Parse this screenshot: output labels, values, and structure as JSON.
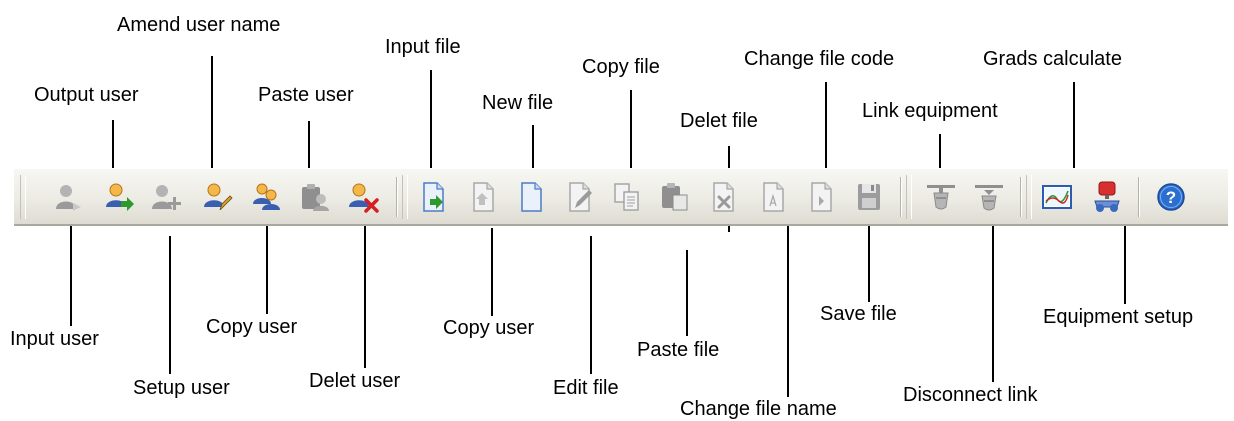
{
  "toolbar": {
    "buttons": [
      {
        "id": "input-user",
        "label": "Input user",
        "icon": "user-input-icon"
      },
      {
        "id": "output-user",
        "label": "Output user",
        "icon": "user-output-icon"
      },
      {
        "id": "setup-user",
        "label": "Setup user",
        "icon": "user-add-icon"
      },
      {
        "id": "amend-user-name",
        "label": "Amend user name",
        "icon": "user-edit-icon"
      },
      {
        "id": "copy-user",
        "label": "Copy user",
        "icon": "user-copy-icon"
      },
      {
        "id": "paste-user",
        "label": "Paste user",
        "icon": "user-paste-icon"
      },
      {
        "id": "delet-user",
        "label": "Delet user",
        "icon": "user-delete-icon"
      },
      {
        "id": "input-file",
        "label": "Input file",
        "icon": "file-import-icon"
      },
      {
        "id": "copy-user-2",
        "label": "Copy user",
        "icon": "file-export-icon"
      },
      {
        "id": "new-file",
        "label": "New file",
        "icon": "file-new-icon"
      },
      {
        "id": "edit-file",
        "label": "Edit file",
        "icon": "file-edit-icon"
      },
      {
        "id": "copy-file",
        "label": "Copy file",
        "icon": "file-copy-icon"
      },
      {
        "id": "paste-file",
        "label": "Paste file",
        "icon": "clipboard-paste-icon"
      },
      {
        "id": "delet-file",
        "label": "Delet file",
        "icon": "file-delete-icon"
      },
      {
        "id": "change-file-name",
        "label": "Change file name",
        "icon": "file-rename-icon"
      },
      {
        "id": "change-file-code",
        "label": "Change file code",
        "icon": "file-code-icon"
      },
      {
        "id": "save-file",
        "label": "Save file",
        "icon": "floppy-disk-icon"
      },
      {
        "id": "link-equipment",
        "label": "Link equipment",
        "icon": "plug-connect-icon"
      },
      {
        "id": "disconnect-link",
        "label": "Disconnect link",
        "icon": "plug-disconnect-icon"
      },
      {
        "id": "grads-calculate",
        "label": "Grads calculate",
        "icon": "chart-calculate-icon"
      },
      {
        "id": "equipment-setup",
        "label": "Equipment setup",
        "icon": "equipment-setup-icon"
      },
      {
        "id": "help",
        "label": "",
        "icon": "help-icon"
      }
    ]
  },
  "callouts": {
    "input_user": "Input user",
    "output_user": "Output user",
    "setup_user": "Setup user",
    "amend_user_name": "Amend user name",
    "copy_user": "Copy user",
    "paste_user": "Paste user",
    "delet_user": "Delet user",
    "input_file": "Input file",
    "copy_user_2": "Copy user",
    "new_file": "New file",
    "edit_file": "Edit file",
    "copy_file": "Copy file",
    "paste_file": "Paste file",
    "delet_file": "Delet file",
    "change_file_name": "Change file name",
    "change_file_code": "Change file code",
    "save_file": "Save file",
    "link_equipment": "Link equipment",
    "disconnect_link": "Disconnect link",
    "grads_calculate": "Grads calculate",
    "equipment_setup": "Equipment setup"
  },
  "colors": {
    "user_orange": "#f0a020",
    "user_gray": "#9a9a9a",
    "arrow_green": "#2e9a2e",
    "delete_red": "#d42020",
    "file_blue": "#4a7cc8",
    "help_blue": "#2a6fd0"
  }
}
